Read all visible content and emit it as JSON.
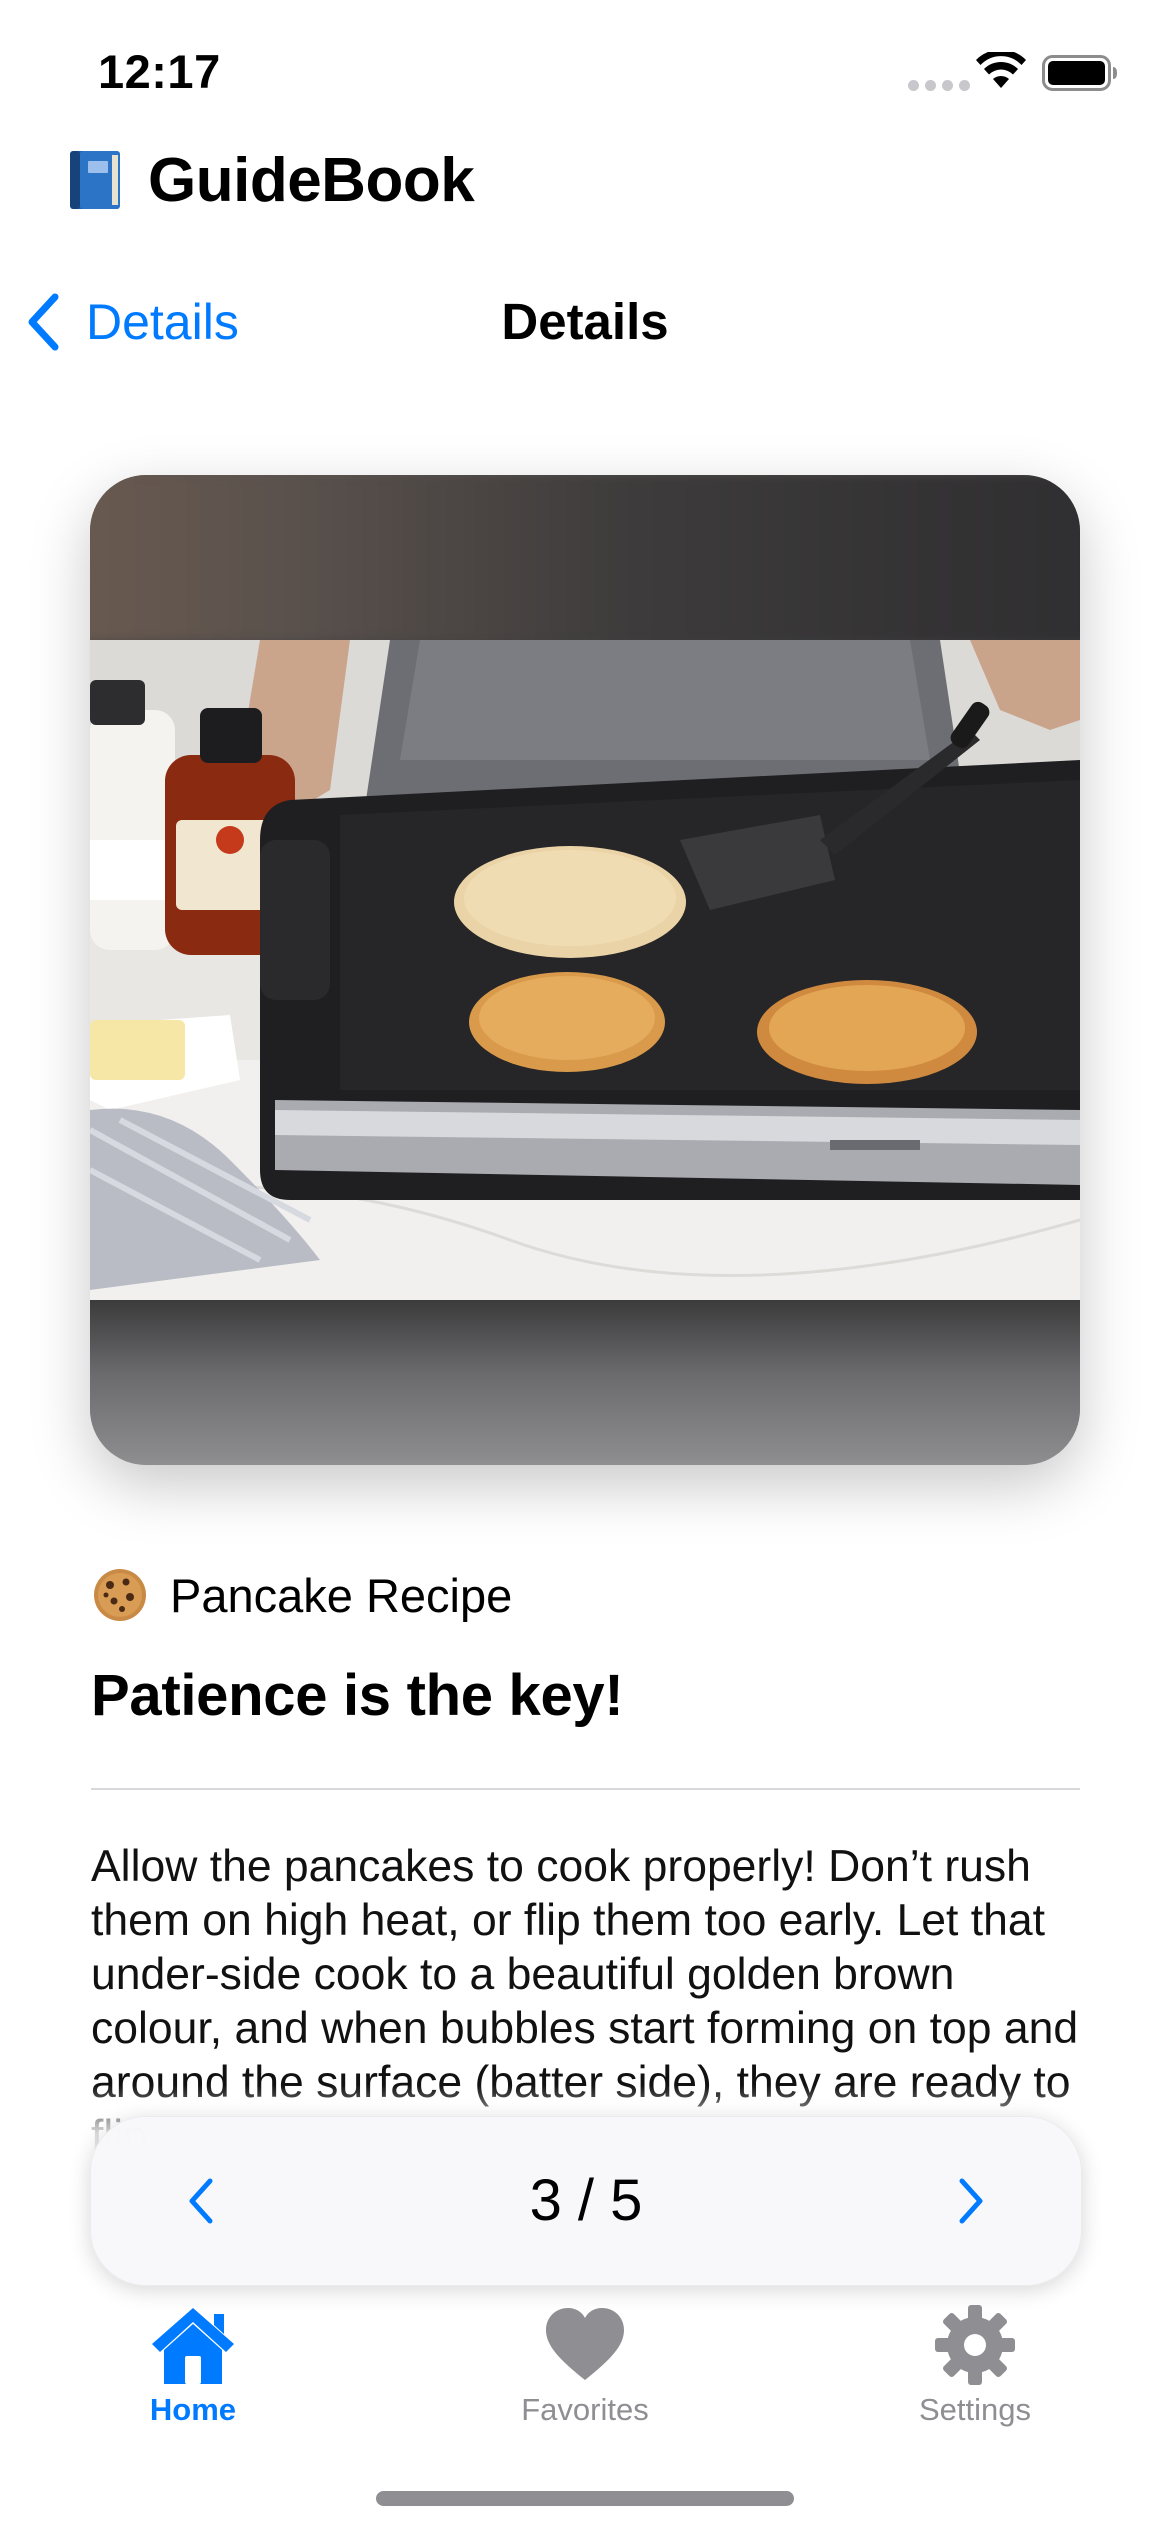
{
  "status_bar": {
    "time": "12:17"
  },
  "app": {
    "title": "GuideBook",
    "icon": "blue-book-icon"
  },
  "nav": {
    "back_label": "Details",
    "title": "Details"
  },
  "card": {
    "photo_subject": "pancakes on griddle"
  },
  "content": {
    "category_icon": "cookie-icon",
    "category": "Pancake Recipe",
    "headline": "Patience is the key!",
    "body": "Allow the pancakes to cook properly! Don’t rush them on high heat, or flip them too early. Let that under-side cook to a beautiful golden brown colour, and when bubbles start forming on top and around the surface (batter side), they are ready to flip."
  },
  "pager": {
    "current": 3,
    "total": 5,
    "label": "3 / 5"
  },
  "tabs": [
    {
      "label": "Home",
      "icon": "house-icon",
      "active": true
    },
    {
      "label": "Favorites",
      "icon": "heart-icon",
      "active": false
    },
    {
      "label": "Settings",
      "icon": "gear-icon",
      "active": false
    }
  ],
  "colors": {
    "accent": "#007aff",
    "inactive": "#8e8e93"
  }
}
